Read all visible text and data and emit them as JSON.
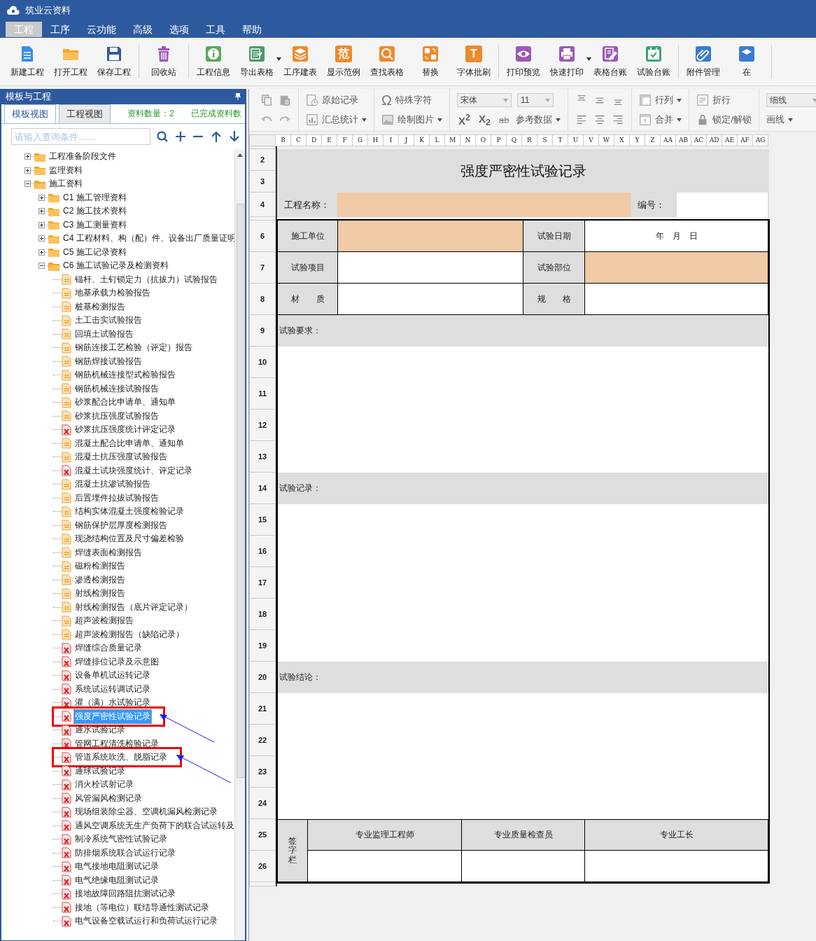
{
  "app_title": "筑业云资料",
  "menu": [
    {
      "label": "工程",
      "selected": true
    },
    {
      "label": "工序",
      "selected": false
    },
    {
      "label": "云功能",
      "selected": false
    },
    {
      "label": "高级",
      "selected": false
    },
    {
      "label": "选项",
      "selected": false
    },
    {
      "label": "工具",
      "selected": false
    },
    {
      "label": "帮助",
      "selected": false
    }
  ],
  "toolbar": [
    [
      {
        "label": "新建工程",
        "color": "#3a8ee6",
        "dropdown": false
      },
      {
        "label": "打开工程",
        "color": "#f5a623",
        "dropdown": false
      },
      {
        "label": "保存工程",
        "color": "#2e5c9e",
        "dropdown": false
      }
    ],
    [
      {
        "label": "回收站",
        "color": "#9b59b6",
        "dropdown": false
      }
    ],
    [
      {
        "label": "工程信息",
        "color": "#5aa85a",
        "dropdown": false
      },
      {
        "label": "导出表格",
        "color": "#4a9a6a",
        "dropdown": true
      },
      {
        "label": "工序建表",
        "color": "#ef8a2a",
        "dropdown": false
      },
      {
        "label": "显示范例",
        "glyph": "范",
        "color": "#ef8a2a",
        "dropdown": false
      },
      {
        "label": "查找表格",
        "color": "#ef8a2a",
        "dropdown": false
      },
      {
        "label": "替换",
        "color": "#ef8a2a",
        "dropdown": false
      },
      {
        "label": "字体批刷",
        "glyph": "T",
        "color": "#ef8a2a",
        "dropdown": false
      }
    ],
    [
      {
        "label": "打印预览",
        "color": "#9b59b6",
        "dropdown": false
      },
      {
        "label": "快速打印",
        "color": "#9b59b6",
        "dropdown": true
      },
      {
        "label": "表格台账",
        "color": "#9b59b6",
        "dropdown": false
      },
      {
        "label": "试验台账",
        "color": "#3aa76d",
        "dropdown": false
      }
    ],
    [
      {
        "label": "附件管理",
        "color": "#3a7bd5",
        "dropdown": false
      },
      {
        "label": "在",
        "color": "#3a7bd5",
        "dropdown": false
      }
    ]
  ],
  "panel": {
    "title": "模板与工程",
    "tabs": [
      {
        "label": "模板视图",
        "selected": true
      },
      {
        "label": "工程视图",
        "selected": false
      }
    ],
    "stats": [
      "资料数量：2",
      "已完成资料数"
    ],
    "search": {
      "placeholder": "请输入查询条件……"
    }
  },
  "tree": [
    {
      "label": "工程准备阶段文件",
      "expanded": false
    },
    {
      "label": "监理资料",
      "expanded": false
    },
    {
      "label": "施工资料",
      "expanded": true,
      "children": [
        {
          "label": "C1  施工管理资料",
          "expanded": false
        },
        {
          "label": "C2  施工技术资料",
          "expanded": false
        },
        {
          "label": "C3  施工测量资料",
          "expanded": false
        },
        {
          "label": "C4  工程材料、构（配）件、设备出厂质量证明",
          "expanded": false
        },
        {
          "label": "C5  施工记录资料",
          "expanded": false
        },
        {
          "label": "C6  施工试验记录及检测资料",
          "expanded": true,
          "files": [
            {
              "label": "锚杆、土钉锁定力（抗拔力）试验报告",
              "kind": "report",
              "selected": false,
              "marked": false
            },
            {
              "label": "地基承载力检验报告",
              "kind": "report",
              "selected": false,
              "marked": false
            },
            {
              "label": "桩基检测报告",
              "kind": "report",
              "selected": false,
              "marked": false
            },
            {
              "label": "土工击实试验报告",
              "kind": "report",
              "selected": false,
              "marked": false
            },
            {
              "label": "回填土试验报告",
              "kind": "report",
              "selected": false,
              "marked": false
            },
            {
              "label": "钢筋连接工艺检验（评定）报告",
              "kind": "report",
              "selected": false,
              "marked": false
            },
            {
              "label": "钢筋焊接试验报告",
              "kind": "report",
              "selected": false,
              "marked": false
            },
            {
              "label": "钢筋机械连接型式检验报告",
              "kind": "report",
              "selected": false,
              "marked": false
            },
            {
              "label": "钢筋机械连接试验报告",
              "kind": "report",
              "selected": false,
              "marked": false
            },
            {
              "label": "砂浆配合比申请单、通知单",
              "kind": "report",
              "selected": false,
              "marked": false
            },
            {
              "label": "砂浆抗压强度试验报告",
              "kind": "report",
              "selected": false,
              "marked": false
            },
            {
              "label": "砂浆抗压强度统计评定记录",
              "kind": "record",
              "selected": false,
              "marked": false
            },
            {
              "label": "混凝土配合比申请单、通知单",
              "kind": "report",
              "selected": false,
              "marked": false
            },
            {
              "label": "混凝土抗压强度试验报告",
              "kind": "report",
              "selected": false,
              "marked": false
            },
            {
              "label": "混凝土试块强度统计、评定记录",
              "kind": "record",
              "selected": false,
              "marked": false
            },
            {
              "label": "混凝土抗渗试验报告",
              "kind": "report",
              "selected": false,
              "marked": false
            },
            {
              "label": "后置埋件拉拔试验报告",
              "kind": "report",
              "selected": false,
              "marked": false
            },
            {
              "label": "结构实体混凝土强度检验记录",
              "kind": "report",
              "selected": false,
              "marked": false
            },
            {
              "label": "钢筋保护层厚度检测报告",
              "kind": "report",
              "selected": false,
              "marked": false
            },
            {
              "label": "现浇结构位置及尺寸偏差检验",
              "kind": "report",
              "selected": false,
              "marked": false
            },
            {
              "label": "焊缝表面检测报告",
              "kind": "report",
              "selected": false,
              "marked": false
            },
            {
              "label": "磁粉检测报告",
              "kind": "report",
              "selected": false,
              "marked": false
            },
            {
              "label": "渗透检测报告",
              "kind": "report",
              "selected": false,
              "marked": false
            },
            {
              "label": "射线检测报告",
              "kind": "report",
              "selected": false,
              "marked": false
            },
            {
              "label": "射线检测报告（底片评定记录）",
              "kind": "report",
              "selected": false,
              "marked": false
            },
            {
              "label": "超声波检测报告",
              "kind": "report",
              "selected": false,
              "marked": false
            },
            {
              "label": "超声波检测报告（缺陷记录）",
              "kind": "report",
              "selected": false,
              "marked": false
            },
            {
              "label": "焊缝综合质量记录",
              "kind": "record",
              "selected": false,
              "marked": false
            },
            {
              "label": "焊缝排位记录及示意图",
              "kind": "record",
              "selected": false,
              "marked": false
            },
            {
              "label": "设备单机试运转记录",
              "kind": "record",
              "selected": false,
              "marked": false
            },
            {
              "label": "系统试运转调试记录",
              "kind": "record",
              "selected": false,
              "marked": false
            },
            {
              "label": "灌（满）水试验记录",
              "kind": "record",
              "selected": false,
              "marked": false
            },
            {
              "label": "强度严密性试验记录",
              "kind": "record",
              "selected": true,
              "marked": true
            },
            {
              "label": "通水试验记录",
              "kind": "record",
              "selected": false,
              "marked": false
            },
            {
              "label": "管网工程清洗检验记录",
              "kind": "record",
              "selected": false,
              "marked": false
            },
            {
              "label": "管道系统吹洗、脱脂记录",
              "kind": "record",
              "selected": false,
              "marked": true
            },
            {
              "label": "通球试验记录",
              "kind": "record",
              "selected": false,
              "marked": false
            },
            {
              "label": "消火栓试射记录",
              "kind": "record",
              "selected": false,
              "marked": false
            },
            {
              "label": "风管漏风检测记录",
              "kind": "record",
              "selected": false,
              "marked": false
            },
            {
              "label": "现场组装除尘器、空调机漏风检测记录",
              "kind": "record",
              "selected": false,
              "marked": false
            },
            {
              "label": "通风空调系统无生产负荷下的联合试运转及",
              "kind": "record",
              "selected": false,
              "marked": false
            },
            {
              "label": "制冷系统气密性试验记录",
              "kind": "record",
              "selected": false,
              "marked": false
            },
            {
              "label": "防排烟系统联合试运行记录",
              "kind": "record",
              "selected": false,
              "marked": false
            },
            {
              "label": "电气接地电阻测试记录",
              "kind": "record",
              "selected": false,
              "marked": false
            },
            {
              "label": "电气绝缘电阻测试记录",
              "kind": "record",
              "selected": false,
              "marked": false
            },
            {
              "label": "接地故障回路阻抗测试记录",
              "kind": "record",
              "selected": false,
              "marked": false
            },
            {
              "label": "接地（等电位）联结导通性测试记录",
              "kind": "record",
              "selected": false,
              "marked": false
            },
            {
              "label": "电气设备空载试运行和负荷试运行记录",
              "kind": "record",
              "selected": false,
              "marked": false
            }
          ]
        }
      ]
    }
  ],
  "format_toolbar": [
    {
      "top": [
        {
          "kind": "button",
          "label": "原始记录",
          "dropdown": false
        }
      ],
      "bottom": [
        {
          "kind": "button",
          "label": "汇总统计",
          "dropdown": true
        }
      ]
    },
    {
      "top": [
        {
          "kind": "button",
          "glyph": "Ω",
          "label": "特殊字符",
          "dropdown": false
        }
      ],
      "bottom": [
        {
          "kind": "button",
          "label": "绘制图片",
          "dropdown": true
        }
      ]
    },
    {
      "top": [
        {
          "kind": "select",
          "value": "宋体"
        },
        {
          "kind": "select",
          "value": "11"
        }
      ],
      "bottom": [
        {
          "kind": "script",
          "text": "X$^{2}$"
        },
        {
          "kind": "script",
          "text": "X$_{2}$"
        },
        {
          "kind": "strike",
          "text": "ab"
        },
        {
          "kind": "button",
          "label": "参考数据",
          "dropdown": true
        }
      ]
    },
    {
      "top": [
        {
          "kind": "button",
          "label": "行列",
          "dropdown": true
        }
      ],
      "bottom": [
        {
          "kind": "button",
          "label": "合并",
          "dropdown": true
        }
      ]
    },
    {
      "top": [
        {
          "kind": "button",
          "label": "折行",
          "dropdown": false
        }
      ],
      "bottom": [
        {
          "kind": "button",
          "label": "锁定/解锁",
          "dropdown": false
        }
      ]
    },
    {
      "top": [
        {
          "kind": "select",
          "value": "细线"
        }
      ],
      "bottom": [
        {
          "kind": "button",
          "label": "画线",
          "dropdown": true
        }
      ]
    }
  ],
  "sheet": {
    "columns": [
      "B",
      "C",
      "D",
      "E",
      "F",
      "G",
      "H",
      "I",
      "J",
      "K",
      "L",
      "M",
      "N",
      "O",
      "P",
      "Q",
      "R",
      "S",
      "T",
      "U",
      "V",
      "W",
      "X",
      "Y",
      "Z",
      "AA",
      "AB",
      "AC",
      "AD",
      "AE",
      "AF",
      "AG"
    ],
    "row_headers": [
      "2",
      "3",
      "4",
      "6",
      "7",
      "8",
      "9",
      "10",
      "11",
      "12",
      "13",
      "14",
      "15",
      "16",
      "17",
      "18",
      "19",
      "20",
      "21",
      "22",
      "23",
      "24",
      "25",
      "26"
    ]
  },
  "form": {
    "title": "强度严密性试验记录",
    "header": [
      {
        "label": "工程名称：",
        "highlighted": true
      },
      {
        "label": "编号：",
        "highlighted": false
      }
    ],
    "info_rows": [
      [
        {
          "label": "施工单位",
          "highlighted": true
        },
        {
          "label": "试验日期",
          "value": "年　月　日",
          "highlighted": false
        }
      ],
      [
        {
          "label": "试验项目",
          "highlighted": false
        },
        {
          "label": "试验部位",
          "highlighted": true
        }
      ],
      [
        {
          "label": "材　　质",
          "highlighted": false
        },
        {
          "label": "规　　格",
          "highlighted": false
        }
      ]
    ],
    "sections": [
      {
        "label": "试验要求："
      },
      {
        "label": "试验记录："
      },
      {
        "label": "试验结论："
      }
    ],
    "signature": {
      "label": "签字栏",
      "roles": [
        "专业监理工程师",
        "专业质量检查员",
        "专业工长"
      ]
    }
  }
}
